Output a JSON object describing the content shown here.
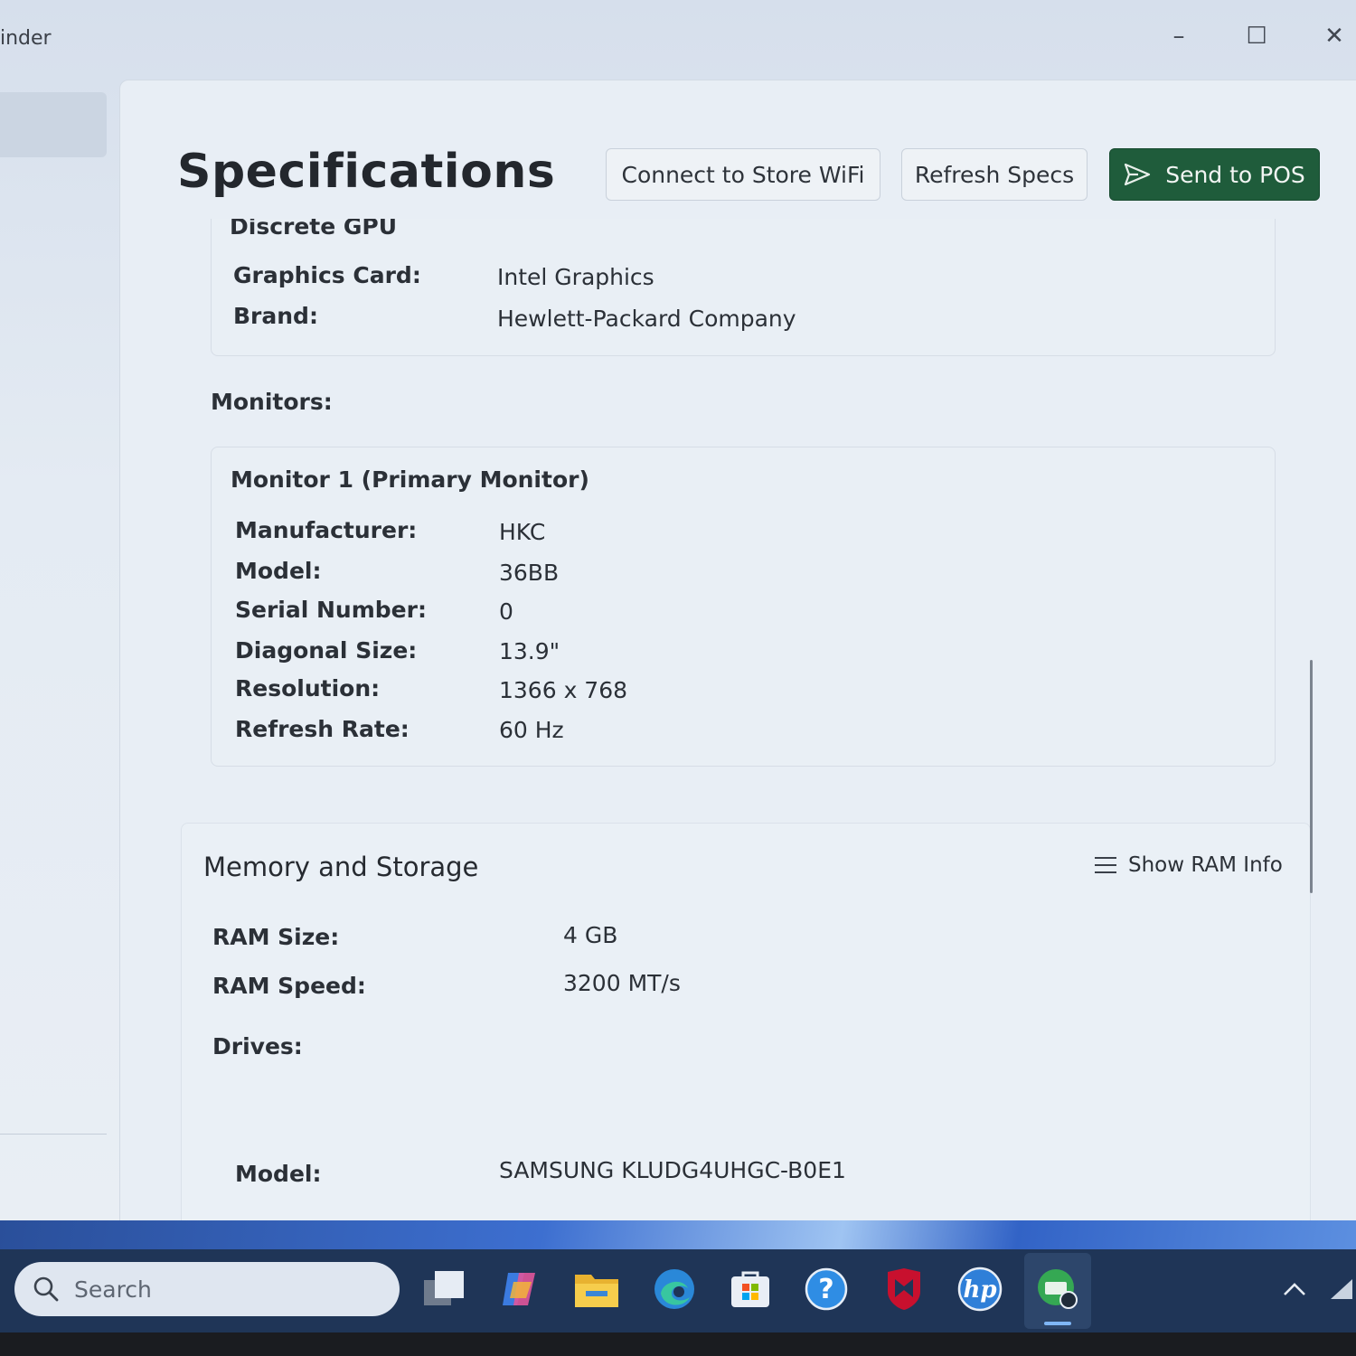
{
  "window": {
    "app_title": "inder",
    "controls": {
      "minimize": "–",
      "maximize": "☐",
      "close": "✕"
    }
  },
  "header": {
    "title": "Specifications",
    "connect_wifi_label": "Connect to Store WiFi",
    "refresh_label": "Refresh Specs",
    "send_pos_label": "Send to POS"
  },
  "gpu": {
    "heading": "Discrete GPU",
    "rows": [
      {
        "label": "Graphics Card:",
        "value": "Intel Graphics"
      },
      {
        "label": "Brand:",
        "value": "Hewlett-Packard Company"
      }
    ]
  },
  "monitors": {
    "label": "Monitors:",
    "monitor1": {
      "heading": "Monitor 1 (Primary Monitor)",
      "rows": [
        {
          "label": "Manufacturer:",
          "value": "HKC"
        },
        {
          "label": "Model:",
          "value": "36BB"
        },
        {
          "label": "Serial Number:",
          "value": "0"
        },
        {
          "label": "Diagonal Size:",
          "value": "13.9\""
        },
        {
          "label": "Resolution:",
          "value": "1366 x 768"
        },
        {
          "label": "Refresh Rate:",
          "value": "60 Hz"
        }
      ]
    }
  },
  "memory": {
    "title": "Memory and Storage",
    "show_ram_label": "Show RAM Info",
    "rows": [
      {
        "label": "RAM Size:",
        "value": "4 GB"
      },
      {
        "label": "RAM Speed:",
        "value": "3200 MT/s"
      }
    ],
    "drives_label": "Drives:",
    "drive": {
      "model_label": "Model:",
      "model_value": "SAMSUNG KLUDG4UHGC-B0E1"
    }
  },
  "taskbar": {
    "search_placeholder": "Search",
    "icons": [
      "task-view-icon",
      "copilot-icon",
      "file-explorer-icon",
      "edge-icon",
      "store-icon",
      "help-icon",
      "mcafee-icon",
      "hp-icon",
      "app-finder-icon"
    ],
    "colors": {
      "accent": "#1f5c3b",
      "taskbar": "#1f3557"
    }
  }
}
